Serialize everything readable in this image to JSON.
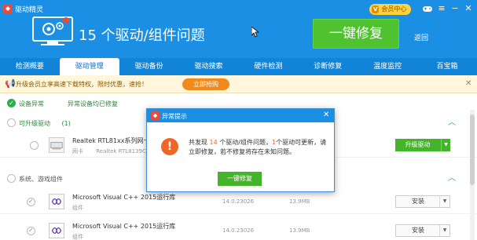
{
  "header": {
    "app_title": "驱动精灵",
    "vip_badge_icon": "V",
    "vip_label": "会员中心",
    "headline": "15 个驱动/组件问题",
    "fix_button": "一键修复",
    "return_link": "返回",
    "controls": {
      "gamepad": "gamepad-icon",
      "menu": "menu-icon",
      "minimize": "minimize-icon",
      "close": "close-icon"
    }
  },
  "tabs": [
    "检测概要",
    "驱动管理",
    "驱动备份",
    "驱动搜索",
    "硬件检测",
    "诊断修复",
    "温度监控",
    "百宝箱"
  ],
  "active_tab": 1,
  "promo": {
    "text": "升级会员立享高速下载特权，限时优惠，速抢！",
    "button": "立即抢购"
  },
  "filter": {
    "label1": "设备异常",
    "label2": "异常设备均已修复"
  },
  "sections": {
    "upgradable": {
      "label": "可升级驱动",
      "count": "(1)"
    },
    "system": {
      "label": "系统、游戏组件"
    }
  },
  "rows": [
    {
      "name": "Realtek RTL81xx系列网卡",
      "sub1": "网卡",
      "sub2": "Realtek RTL8139C",
      "button": "升级驱动"
    },
    {
      "name": "Microsoft Visual C++ 2015运行库",
      "sub": "组件",
      "version": "14.0.23026",
      "size": "13.9MB",
      "button": "安装"
    },
    {
      "name": "Microsoft Visual C++ 2015运行库",
      "sub": "组件",
      "version": "14.0.23026",
      "size": "13.9MB",
      "button": "安装"
    }
  ],
  "dialog": {
    "title": "异常提示",
    "msg_a": "共发现 ",
    "msg_count1": "14",
    "msg_b": " 个驱动/组件问题，",
    "msg_count2": "1",
    "msg_c": "个驱动可更新，请立即修复，若不修复将存在未知问题。",
    "button": "一键修复"
  },
  "colors": {
    "primary": "#1a8fe3",
    "green": "#44b52b",
    "warn": "#f26526"
  }
}
